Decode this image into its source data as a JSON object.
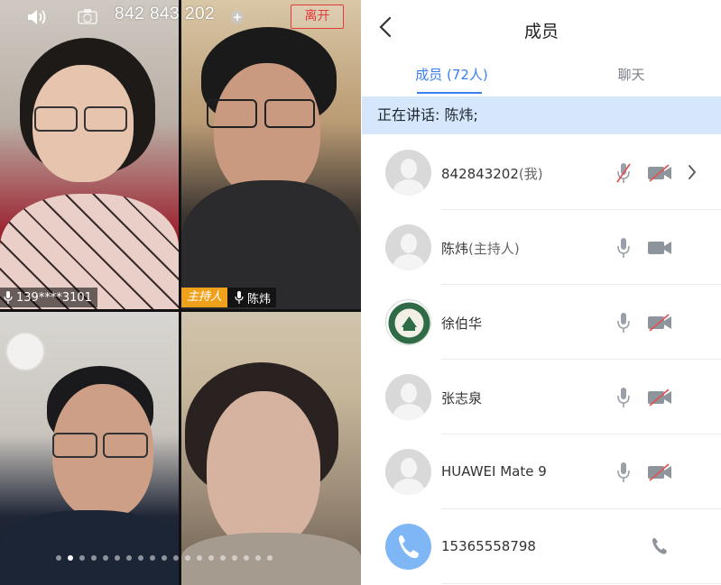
{
  "call": {
    "meeting_id": "842 843 202",
    "leave_label": "离开"
  },
  "tiles": [
    {
      "name": "139****3101",
      "host": false
    },
    {
      "name": "陈炜",
      "host": true,
      "host_badge": "主持人"
    },
    {
      "name": "",
      "host": false
    },
    {
      "name": "",
      "host": false
    }
  ],
  "pagination": {
    "total": 19,
    "active_index": 1
  },
  "panel": {
    "title": "成员",
    "tabs": [
      {
        "label": "成员 (72人)",
        "active": true
      },
      {
        "label": "聊天",
        "active": false
      }
    ],
    "speaking": "正在讲话: 陈炜;"
  },
  "members": [
    {
      "name": "842843202",
      "role": "(我)",
      "avatar": "default",
      "mic": "muted",
      "camera": "off",
      "has_detail": true
    },
    {
      "name": "陈炜",
      "role": "(主持人)",
      "avatar": "default",
      "mic": "on",
      "camera": "on",
      "has_detail": false
    },
    {
      "name": "徐伯华",
      "role": "",
      "avatar": "university-seal",
      "mic": "on",
      "camera": "off",
      "has_detail": false
    },
    {
      "name": "张志泉",
      "role": "",
      "avatar": "default",
      "mic": "on",
      "camera": "off",
      "has_detail": false
    },
    {
      "name": "HUAWEI Mate 9",
      "role": "",
      "avatar": "default",
      "mic": "on",
      "camera": "off",
      "has_detail": false
    },
    {
      "name": "15365558798",
      "role": "",
      "avatar": "phone",
      "mic": "none",
      "camera": "phone",
      "has_detail": false
    }
  ],
  "colors": {
    "accent": "#3a7ef0",
    "leave": "#e23c3c",
    "host_badge": "#f0a11c",
    "speaking_bg": "#d7e7fb",
    "muted": "#e35454"
  },
  "icons": [
    "speaker-icon",
    "camera-switch-icon",
    "shield-icon",
    "mic-icon",
    "camera-icon",
    "back-icon",
    "chevron-right-icon",
    "phone-icon"
  ]
}
